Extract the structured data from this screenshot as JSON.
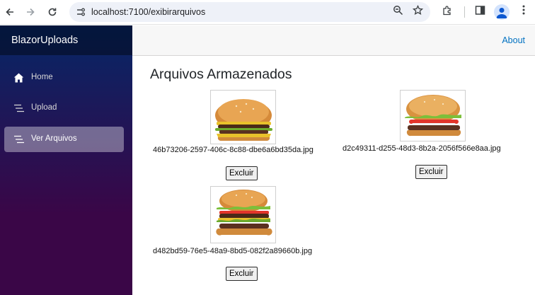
{
  "browser": {
    "url": "localhost:7100/exibirarquivos"
  },
  "app": {
    "brand": "BlazorUploads",
    "about_link": "About"
  },
  "sidebar": {
    "items": [
      {
        "label": "Home",
        "icon": "home-icon"
      },
      {
        "label": "Upload",
        "icon": "list-icon"
      },
      {
        "label": "Ver Arquivos",
        "icon": "list-icon",
        "active": true
      }
    ]
  },
  "main": {
    "title": "Arquivos Armazenados",
    "files": [
      {
        "name": "46b73206-2597-406c-8c88-dbe6a6bd35da.jpg",
        "delete_label": "Excluir"
      },
      {
        "name": "d2c49311-d255-48d3-8b2a-2056f566e8aa.jpg",
        "delete_label": "Excluir"
      },
      {
        "name": "d482bd59-76e5-48a9-8bd5-082f2a89660b.jpg",
        "delete_label": "Excluir"
      }
    ]
  },
  "colors": {
    "sidebar_top": "#052767",
    "sidebar_bottom": "#3a0647",
    "link": "#0071c1"
  }
}
